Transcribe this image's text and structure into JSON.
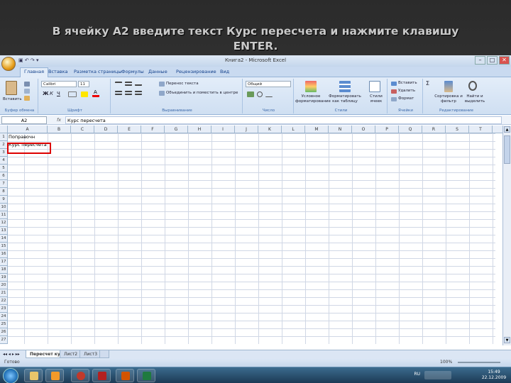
{
  "slide": {
    "title_line1": "В ячейку А2 введите текст Курс пересчета и нажмите клавишу",
    "title_line2": "ENTER."
  },
  "window": {
    "title": "Книга2 - Microsoft Excel",
    "qat": "▣ ↶ ↷ ▾"
  },
  "tabs": [
    "Главная",
    "Вставка",
    "Разметка страницы",
    "Формулы",
    "Данные",
    "Рецензирование",
    "Вид"
  ],
  "ribbon": {
    "paste_label": "Вставить",
    "clipboard_label": "Буфер обмена",
    "font_name": "Calibri",
    "font_size": "11",
    "font_label": "Шрифт",
    "bold": "Ж",
    "italic": "К",
    "underline": "Ч",
    "wrap_text": "Перенос текста",
    "merge_center": "Объединить и поместить в центре",
    "alignment_label": "Выравнивание",
    "number_format": "Общий",
    "number_label": "Число",
    "cond_format": "Условное форматирование",
    "format_table": "Форматировать как таблицу",
    "cell_styles": "Стили ячеек",
    "styles_label": "Стили",
    "insert": "Вставить",
    "delete": "Удалить",
    "format": "Формат",
    "cells_label": "Ячейки",
    "sort_filter": "Сортировка и фильтр",
    "find_select": "Найти и выделить",
    "editing_label": "Редактирование",
    "sum": "Σ"
  },
  "formula_bar": {
    "name_box": "A2",
    "fx": "fx",
    "content": "Курс пересчета"
  },
  "columns": [
    "A",
    "B",
    "C",
    "D",
    "E",
    "F",
    "G",
    "H",
    "I",
    "J",
    "K",
    "L",
    "M",
    "N",
    "O",
    "P",
    "Q",
    "R",
    "S",
    "T"
  ],
  "rows": [
    "1",
    "2",
    "3",
    "4",
    "5",
    "6",
    "7",
    "8",
    "9",
    "10",
    "11",
    "12",
    "13",
    "14",
    "15",
    "16",
    "17",
    "18",
    "19",
    "20",
    "21",
    "22",
    "23",
    "24",
    "25",
    "26",
    "27"
  ],
  "cells": {
    "A1": "Поправочн",
    "A2": "Курс пересчета"
  },
  "sheet_tabs": [
    "Пересчет курса",
    "Лист2",
    "Лист3"
  ],
  "status": {
    "ready": "Готово",
    "zoom": "100%"
  },
  "taskbar": {
    "lang": "RU",
    "time": "15:49",
    "date": "22.12.2009"
  },
  "colors": {
    "excel_green": "#1f7a3f",
    "ribbon_blue": "#c9daf0",
    "highlight": "#dd0000"
  }
}
